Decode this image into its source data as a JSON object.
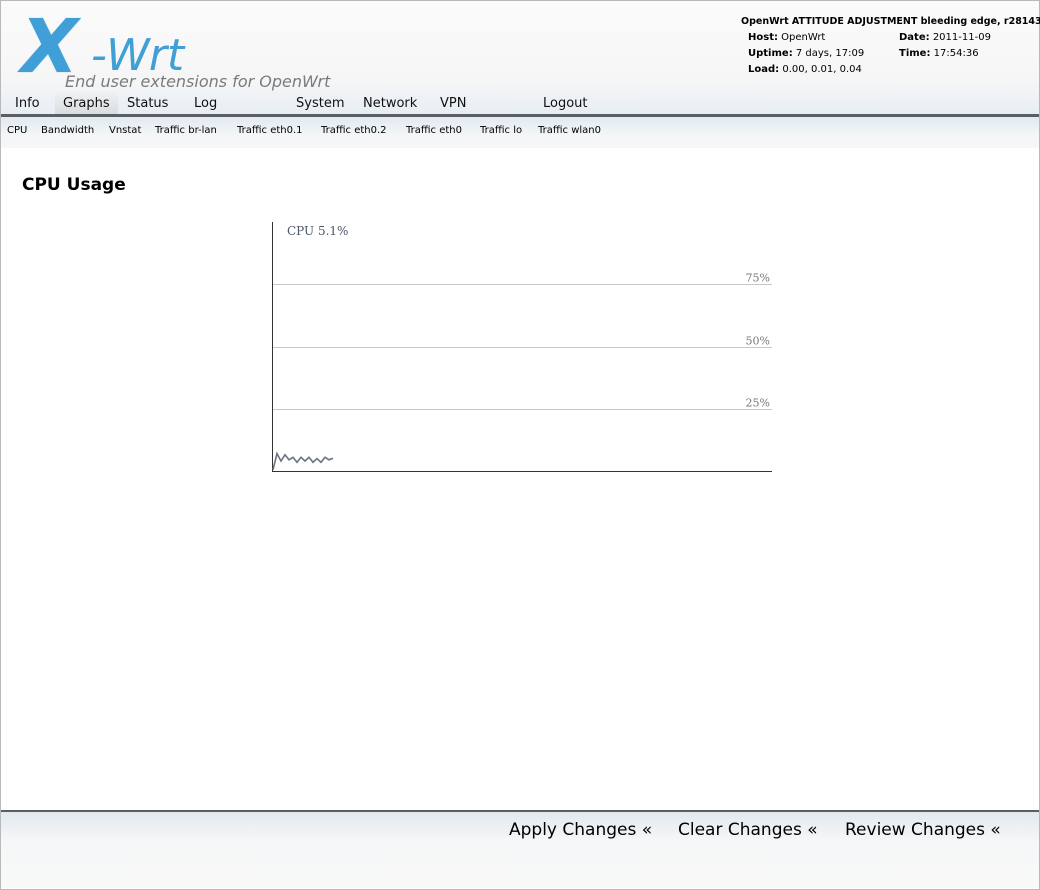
{
  "logo": {
    "x": "X",
    "wrt": "-Wrt",
    "tagline": "End user extensions for OpenWrt"
  },
  "sysinfo": {
    "title": "OpenWrt ATTITUDE ADJUSTMENT bleeding edge, r28143",
    "host_label": "Host:",
    "host": "OpenWrt",
    "date_label": "Date:",
    "date": "2011-11-09",
    "uptime_label": "Uptime:",
    "uptime": "7 days, 17:09",
    "time_label": "Time:",
    "time": "17:54:36",
    "load_label": "Load:",
    "load": "0.00, 0.01, 0.04"
  },
  "main_nav": [
    "Info",
    "Graphs",
    "Status",
    "Log",
    "System",
    "Network",
    "VPN",
    "Logout"
  ],
  "sub_nav": [
    "CPU",
    "Bandwidth",
    "Vnstat",
    "Traffic br-lan",
    "Traffic eth0.1",
    "Traffic eth0.2",
    "Traffic eth0",
    "Traffic lo",
    "Traffic wlan0"
  ],
  "page_title": "CPU Usage",
  "chart_data": {
    "type": "line",
    "title": "CPU 5.1%",
    "ylim": [
      0,
      100
    ],
    "yticks": [
      25,
      50,
      75
    ],
    "ytick_labels": [
      "25%",
      "50%",
      "75%"
    ],
    "grid": true,
    "series": [
      {
        "values": [
          0.5,
          7,
          4,
          6.5,
          4.5,
          5.5,
          3.5,
          5.5,
          4,
          5.5,
          3.5,
          5,
          3.5,
          5.5,
          4.5,
          5.1
        ]
      }
    ]
  },
  "footer": {
    "apply": "Apply Changes «",
    "clear": "Clear Changes «",
    "review": "Review Changes «"
  },
  "colors": {
    "logo_blue": "#3f9fd6",
    "nav_bar": "#5a5f63",
    "series_line": "#6b7382",
    "grid": "#c8c8c8"
  }
}
